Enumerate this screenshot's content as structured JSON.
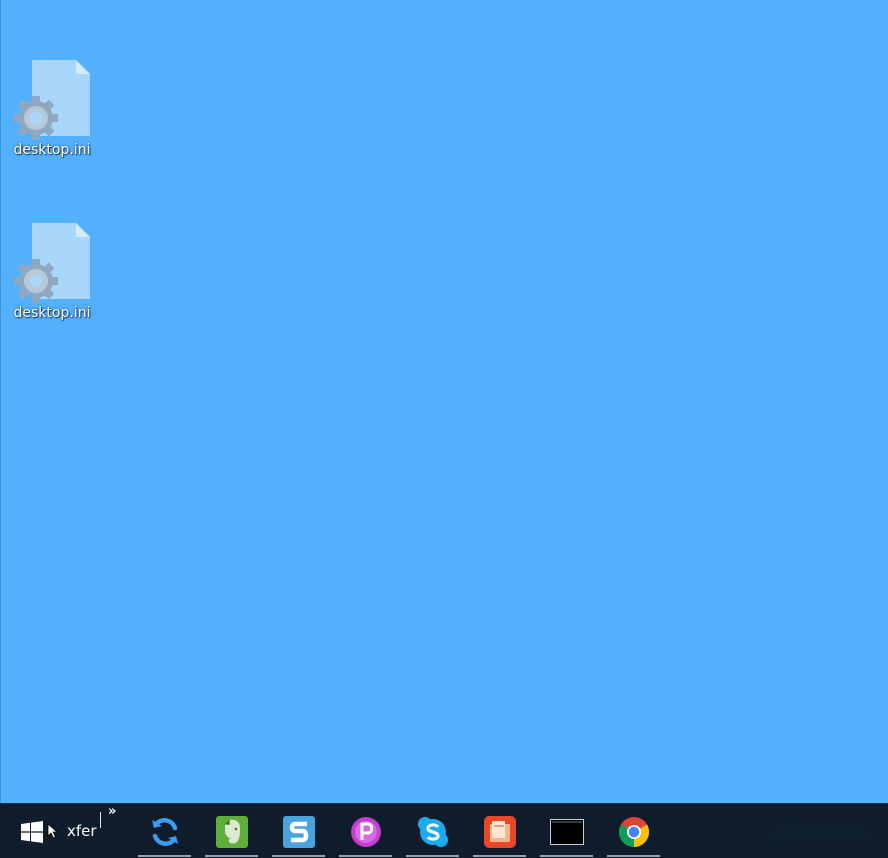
{
  "desktop": {
    "background_color": "#53b0fd",
    "partial_icon_label": "",
    "icons": [
      {
        "label": "desktop.ini",
        "icon": "settings-file-icon"
      },
      {
        "label": "desktop.ini",
        "icon": "settings-file-icon"
      }
    ]
  },
  "taskbar": {
    "background_color": "#0e1c2b",
    "start_icon": "windows-logo-icon",
    "toolbar_label": "xfer",
    "toolbar_overflow_icon": "double-chevron-right-icon",
    "toolbar_overflow_glyph": "»",
    "apps": [
      {
        "name": "sync",
        "icon": "sync-icon",
        "color": "#3a9bf0"
      },
      {
        "name": "evernote",
        "icon": "evernote-icon",
        "color": "#5fae3a"
      },
      {
        "name": "snagit",
        "icon": "snagit-icon",
        "color": "#4aa3df"
      },
      {
        "name": "picpick",
        "icon": "picpick-icon",
        "color": "#c03fcf"
      },
      {
        "name": "skype",
        "icon": "skype-icon",
        "color": "#1eaaf1"
      },
      {
        "name": "slides",
        "icon": "slides-icon",
        "color": "#e8472a"
      },
      {
        "name": "terminal",
        "icon": "terminal-icon",
        "color": "#000000"
      },
      {
        "name": "chrome",
        "icon": "chrome-icon",
        "color": "#db4437"
      }
    ]
  }
}
